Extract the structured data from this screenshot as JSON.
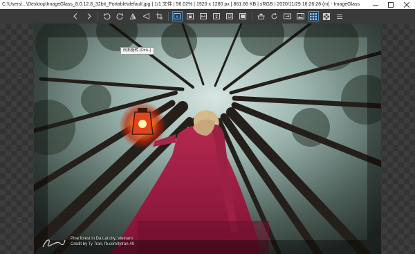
{
  "window": {
    "title": "C:\\Users\\...\\Desktop\\ImageGlass_8.0.12.8_32bit_Portable\\default.jpg  |  1/1 文件  |  56.02%  |  1920 x 1280 px  |  861.66 KB  |  sRGB  |  2020/11/29 16:26:28 (m)  - ImageGlass"
  },
  "toolbar": {
    "tooltip": "向右旋转 (Ctrl+.)",
    "buttons": [
      {
        "name": "prev-image-button",
        "icon": "chevron-left-icon"
      },
      {
        "name": "next-image-button",
        "icon": "chevron-right-icon"
      },
      {
        "name": "rotate-left-button",
        "icon": "rotate-left-icon"
      },
      {
        "name": "rotate-right-button",
        "icon": "rotate-right-icon"
      },
      {
        "name": "flip-horizontal-button",
        "icon": "flip-horizontal-icon"
      },
      {
        "name": "flip-vertical-button",
        "icon": "flip-vertical-icon"
      },
      {
        "name": "crop-button",
        "icon": "crop-icon"
      },
      {
        "name": "auto-zoom-button",
        "icon": "auto-zoom-icon",
        "active": true
      },
      {
        "name": "lock-zoom-button",
        "icon": "lock-zoom-icon"
      },
      {
        "name": "scale-width-button",
        "icon": "scale-width-icon"
      },
      {
        "name": "scale-height-button",
        "icon": "scale-height-icon"
      },
      {
        "name": "scale-fit-button",
        "icon": "scale-fit-icon"
      },
      {
        "name": "scale-fill-button",
        "icon": "scale-fill-icon"
      },
      {
        "name": "open-file-button",
        "icon": "folder-icon"
      },
      {
        "name": "refresh-button",
        "icon": "refresh-icon"
      },
      {
        "name": "goto-image-button",
        "icon": "goto-icon"
      },
      {
        "name": "view-image-button",
        "icon": "image-icon"
      },
      {
        "name": "thumbnail-button",
        "icon": "grid-icon",
        "active": true
      },
      {
        "name": "checkerboard-button",
        "icon": "checkerboard-icon"
      },
      {
        "name": "menu-button",
        "icon": "menu-icon"
      }
    ]
  },
  "caption": {
    "line1": "Pine forest in Da Lat city, Vietnam",
    "line2": "Credit by Ty Tran, fb.com/tytran.49"
  },
  "colors": {
    "titlebar_bg": "#ffffff",
    "toolbar_bg": "#3a3a3a",
    "active_button_border": "#4f8fc2",
    "viewer_bg": "#3d3d3d"
  }
}
